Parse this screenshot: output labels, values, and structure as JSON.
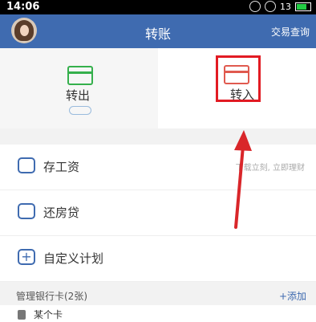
{
  "status_bar": {
    "time": "14:06",
    "signal_text": "13"
  },
  "header": {
    "title": "转账",
    "right_link": "交易查询"
  },
  "tabs": {
    "out_label": "转出",
    "in_label": "转入"
  },
  "list": [
    {
      "label": "存工资",
      "hint": "下载立刻, 立即理财"
    },
    {
      "label": "还房贷",
      "hint": ""
    },
    {
      "label": "自定义计划",
      "hint": ""
    }
  ],
  "section": {
    "label": "管理银行卡(2张)",
    "add_label": "+添加"
  },
  "account": {
    "name": "某个卡"
  },
  "colors": {
    "header_bg": "#3f6bb0",
    "highlight": "#e21b23"
  },
  "icons": [
    "wifi-icon",
    "battery-icon",
    "card-out-icon",
    "card-in-icon",
    "piggy-bank-icon",
    "house-icon",
    "plus-square-icon"
  ]
}
